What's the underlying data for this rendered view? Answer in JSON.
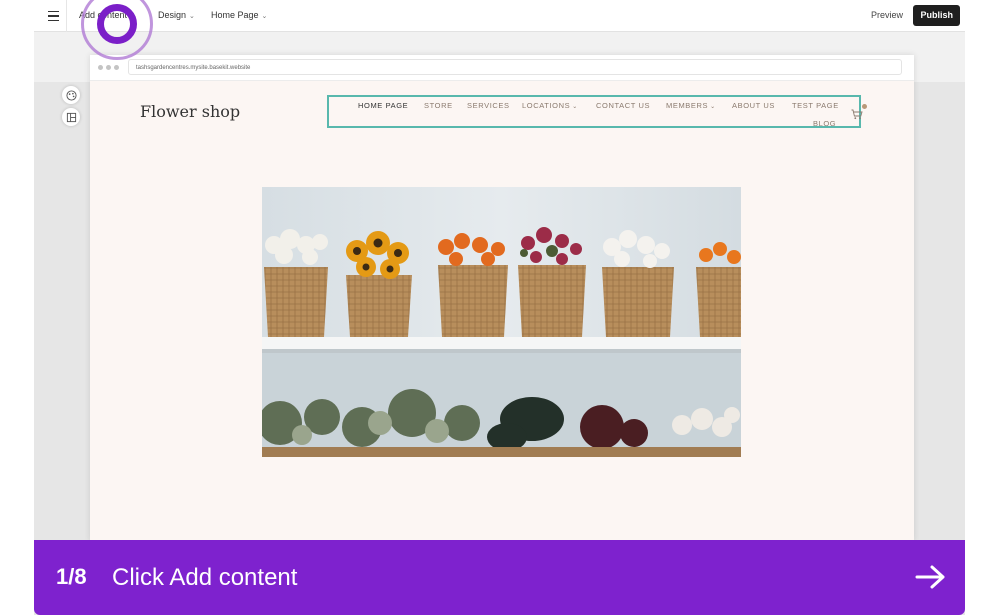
{
  "editor": {
    "toolbar": {
      "menu_icon": "hamburger-menu-icon",
      "add_content_label": "Add content",
      "design_label": "Design",
      "page_selector_label": "Home Page",
      "preview_label": "Preview",
      "publish_label": "Publish"
    },
    "side_tools": {
      "theme_icon": "palette-icon",
      "layout_icon": "layout-icon"
    }
  },
  "browser": {
    "url": "tashsgardencentres.mysite.basekit.website"
  },
  "site": {
    "logo_text": "Flower shop",
    "nav": [
      {
        "label": "HOME PAGE",
        "has_dropdown": false,
        "active": true
      },
      {
        "label": "STORE",
        "has_dropdown": false,
        "active": false
      },
      {
        "label": "SERVICES",
        "has_dropdown": false,
        "active": false
      },
      {
        "label": "LOCATIONS",
        "has_dropdown": true,
        "active": false
      },
      {
        "label": "CONTACT US",
        "has_dropdown": false,
        "active": false
      },
      {
        "label": "MEMBERS",
        "has_dropdown": true,
        "active": false
      },
      {
        "label": "ABOUT US",
        "has_dropdown": false,
        "active": false
      },
      {
        "label": "TEST PAGE",
        "has_dropdown": false,
        "active": false
      },
      {
        "label": "BLOG",
        "has_dropdown": false,
        "active": false
      }
    ],
    "cart_icon": "shopping-cart-icon",
    "hero_image": "flower-baskets-photo"
  },
  "tour": {
    "step": "1/8",
    "instruction": "Click Add content",
    "next_icon": "arrow-right-icon"
  },
  "colors": {
    "accent": "#7e22ce",
    "nav_highlight": "#58b8ad",
    "publish_bg": "#1f1f1f",
    "site_bg": "#fcf6f3"
  }
}
